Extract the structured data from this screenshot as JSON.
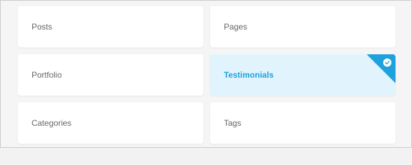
{
  "cards": [
    {
      "label": "Posts",
      "selected": false
    },
    {
      "label": "Pages",
      "selected": false
    },
    {
      "label": "Portfolio",
      "selected": false
    },
    {
      "label": "Testimonials",
      "selected": true
    },
    {
      "label": "Categories",
      "selected": false
    },
    {
      "label": "Tags",
      "selected": false
    }
  ],
  "colors": {
    "accent": "#1ea1dc",
    "selected_bg": "#e1f4fd",
    "card_bg": "#ffffff",
    "text": "#666666"
  },
  "icons": {
    "selected_indicator": "check-icon"
  }
}
